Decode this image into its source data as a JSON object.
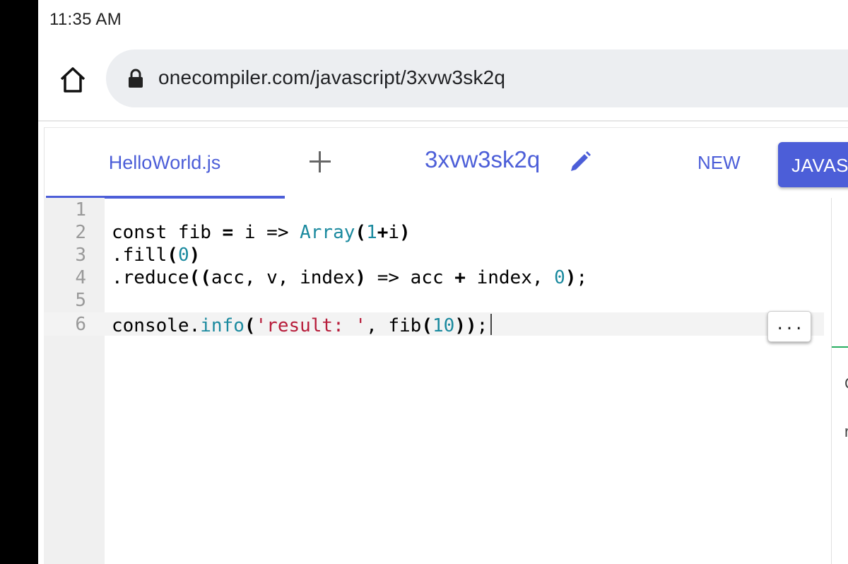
{
  "status_bar": {
    "time": "11:35 AM"
  },
  "browser": {
    "url": "onecompiler.com/javascript/3xvw3sk2q"
  },
  "editor": {
    "file_tab": "HelloWorld.js",
    "code_id": "3xvw3sk2q",
    "new_label": "NEW",
    "language_label": "JAVASC",
    "line_numbers": [
      "1",
      "2",
      "3",
      "4",
      "5",
      "6"
    ],
    "more_label": "...",
    "lines": {
      "l2": {
        "a": "const fib ",
        "op": "=",
        "b": " i => ",
        "fn": "Array",
        "paren1": "(",
        "n1": "1",
        "plus": "+",
        "c": "i",
        "paren2": ")"
      },
      "l3": {
        "a": ".fill",
        "paren1": "(",
        "n": "0",
        "paren2": ")"
      },
      "l4": {
        "a": ".reduce",
        "paren1": "((",
        "b": "acc, v, index",
        "paren2": ")",
        "c": " => acc ",
        "plus": "+",
        "d": " index, ",
        "n": "0",
        "paren3": ")",
        "e": ";"
      },
      "l6": {
        "a": "console.",
        "fn": "info",
        "paren1": "(",
        "s": "'result: '",
        "b": ", fib",
        "paren2": "(",
        "n": "10",
        "paren3": "))",
        "e": ";"
      }
    }
  },
  "output_panel": {
    "partial_1": "C",
    "partial_2": "r"
  }
}
